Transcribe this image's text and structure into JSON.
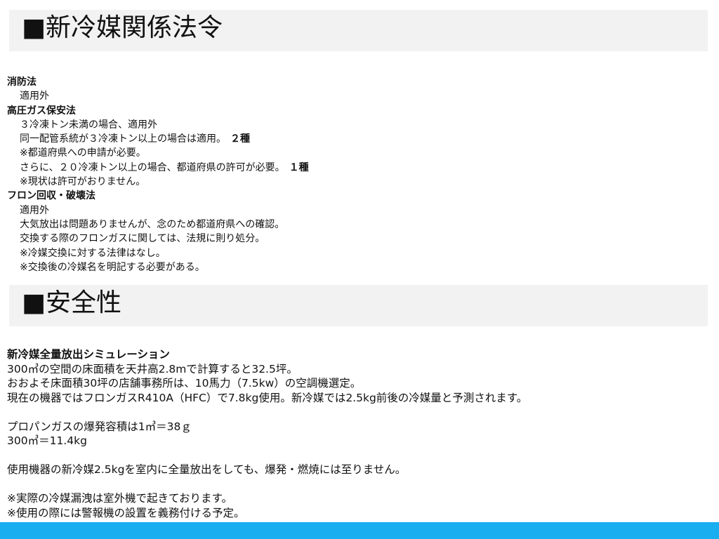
{
  "sections": {
    "law": {
      "title": "■新冷媒関係法令",
      "fire_law": {
        "heading": "消防法",
        "line1": "適用外"
      },
      "gas_law": {
        "heading": "高圧ガス保安法",
        "line1": "３冷凍トン未満の場合、適用外",
        "line2": "同一配管系統が３冷凍トン以上の場合は適用。",
        "line2_grade": "２種",
        "line3": "※都道府県への申請が必要。",
        "line4": "さらに、２０冷凍トン以上の場合、都道府県の許可が必要。",
        "line4_grade": "１種",
        "line5": "※現状は許可がおりません。"
      },
      "freon_law": {
        "heading": "フロン回収・破壊法",
        "line1": "適用外",
        "line2": "大気放出は問題ありませんが、念のため都道府県への確認。",
        "line3": "交換する際のフロンガスに関しては、法規に則り処分。",
        "line4": "※冷媒交換に対する法律はなし。",
        "line5": "※交換後の冷媒名を明記する必要がある。"
      }
    },
    "safety": {
      "title": "■安全性",
      "sim_heading": "新冷媒全量放出シミュレーション",
      "line1": "300㎥の空間の床面積を天井高2.8mで計算すると32.5坪。",
      "line2": "おおよそ床面積30坪の店舗事務所は、10馬力（7.5kw）の空調機選定。",
      "line3": "現在の機器ではフロンガスR410A（HFC）で7.8kg使用。新冷媒では2.5kg前後の冷媒量と予測されます。",
      "line4": "プロパンガスの爆発容積は1㎥＝38ｇ",
      "line5": "300㎥＝11.4kg",
      "line6": "使用機器の新冷媒2.5kgを室内に全量放出をしても、爆発・燃焼には至りません。",
      "line7": "※実際の冷媒漏洩は室外機で起きております。",
      "line8": "※使用の際には警報機の設置を義務付ける予定。"
    }
  },
  "colors": {
    "header_bg": "#f2f2f2",
    "footer_bar": "#19aef0"
  }
}
